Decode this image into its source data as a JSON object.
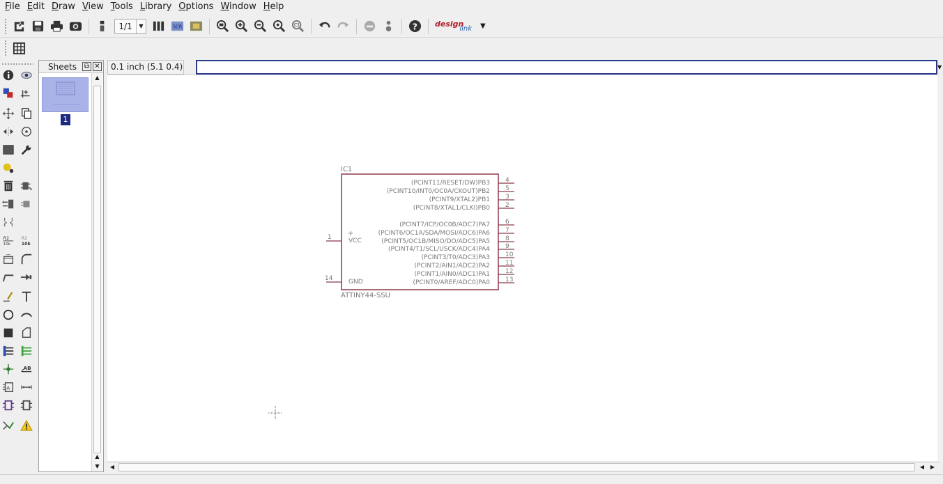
{
  "menu": [
    "File",
    "Edit",
    "Draw",
    "View",
    "Tools",
    "Library",
    "Options",
    "Window",
    "Help"
  ],
  "toolbar": {
    "sheet_value": "1/1",
    "logo_text_1": "design",
    "logo_text_2": "link"
  },
  "sheets_panel": {
    "title": "Sheets",
    "sheet_number": "1"
  },
  "coordinate_display": "0.1 inch (5.1 0.4)",
  "command_input": {
    "value": "",
    "placeholder": ""
  },
  "schematic": {
    "part_name": "IC1",
    "part_value": "ATTINY44-SSU",
    "left_pins": [
      {
        "number": "1",
        "name": "VCC",
        "marker": "+"
      },
      {
        "number": "14",
        "name": "GND"
      }
    ],
    "right_pins": [
      {
        "label": "(PCINT11/RESET/DW)PB3",
        "number": "4"
      },
      {
        "label": "(PCINT10/INT0/OC0A/CKOUT)PB2",
        "number": "5"
      },
      {
        "label": "(PCINT9/XTAL2)PB1",
        "number": "3"
      },
      {
        "label": "(PCINT8/XTAL1/CLKI)PB0",
        "number": "2"
      },
      {
        "label": "(PCINT7/ICP/OC0B/ADC7)PA7",
        "number": "6"
      },
      {
        "label": "(PCINT6/OC1A/SDA/MOSI/ADC6)PA6",
        "number": "7"
      },
      {
        "label": "(PCINT5/OC1B/MISO/DO/ADC5)PA5",
        "number": "8"
      },
      {
        "label": "(PCINT4/T1/SCL/USCK/ADC4)PA4",
        "number": "9"
      },
      {
        "label": "(PCINT3/T0/ADC3)PA3",
        "number": "10"
      },
      {
        "label": "(PCINT2/AIN1/ADC2)PA2",
        "number": "11"
      },
      {
        "label": "(PCINT1/AIN0/ADC1)PA1",
        "number": "12"
      },
      {
        "label": "(PCINT0/AREF/ADC0)PA0",
        "number": "13"
      }
    ]
  },
  "palette_labels": {
    "name_tool": "R2",
    "value_tool": "10k",
    "value_tool_2": "R2",
    "value_tool_3": "10k",
    "label_tool": "AB"
  },
  "colors": {
    "symbol_outline": "#8b3a4a",
    "symbol_text": "#7a7a7a",
    "command_border": "#2b3a8c",
    "sheet_thumb": "#aab3e8"
  }
}
